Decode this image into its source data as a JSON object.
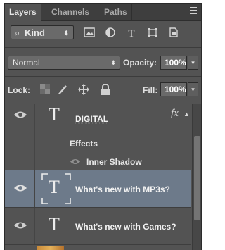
{
  "tabs": [
    {
      "label": "Layers",
      "active": true
    },
    {
      "label": "Channels",
      "active": false
    },
    {
      "label": "Paths",
      "active": false
    }
  ],
  "filter": {
    "kind_label": "Kind",
    "icons": [
      "image-filter-icon",
      "adjustment-filter-icon",
      "type-filter-icon",
      "shape-filter-icon",
      "smart-object-filter-icon"
    ]
  },
  "blend": {
    "mode": "Normal",
    "opacity_label": "Opacity:",
    "opacity_value": "100%"
  },
  "lock": {
    "label": "Lock:",
    "icons": [
      "lock-transparent-icon",
      "lock-image-icon",
      "lock-position-icon",
      "lock-all-icon"
    ],
    "fill_label": "Fill:",
    "fill_value": "100%"
  },
  "layers": [
    {
      "name": "DIGITAL",
      "type_glyph": "T",
      "fx_label": "fx",
      "effects_label": "Effects",
      "effect_items": [
        "Inner Shadow"
      ],
      "selected": false
    },
    {
      "name": "What's new with MP3s?",
      "type_glyph": "T",
      "selected": true
    },
    {
      "name": "What's new with Games?",
      "type_glyph": "T",
      "selected": false
    }
  ],
  "colors": {
    "panel_bg": "#535353",
    "selected_row": "#6d7a8a",
    "text": "#f2f2f2"
  }
}
